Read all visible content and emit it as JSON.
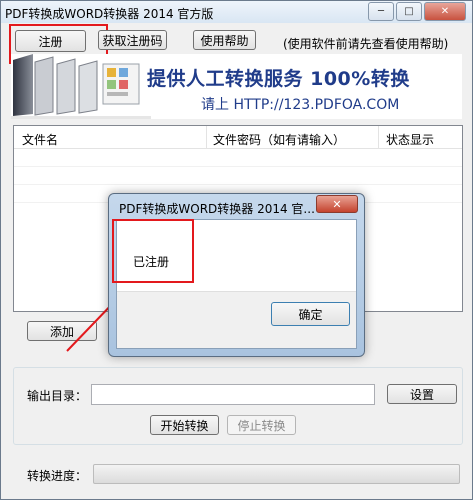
{
  "window": {
    "title": "PDF转换成WORD转换器 2014 官方版",
    "minimize_glyph": "─",
    "maximize_glyph": "□",
    "close_glyph": "✕"
  },
  "toolbar": {
    "register_label": "注册",
    "get_code_label": "获取注册码",
    "help_label": "使用帮助",
    "hint": "(使用软件前请先查看使用帮助)"
  },
  "banner": {
    "headline": "提供人工转换服务 100%转换",
    "subline": "请上  HTTP://123.PDFOA.COM"
  },
  "file_list": {
    "columns": [
      "文件名",
      "文件密码（如有请输入）",
      "状态显示"
    ],
    "rows": []
  },
  "actions": {
    "add_label": "添加",
    "output_dir_label": "输出目录：",
    "output_dir_value": "",
    "settings_label": "设置",
    "start_label": "开始转换",
    "stop_label": "停止转换",
    "progress_label": "转换进度：",
    "progress_fraction": 0
  },
  "dialog": {
    "title": "PDF转换成WORD转换器 2014 官...",
    "message": "已注册",
    "ok_label": "确定",
    "close_glyph": "✕"
  },
  "annotation_color": "#e3191d"
}
